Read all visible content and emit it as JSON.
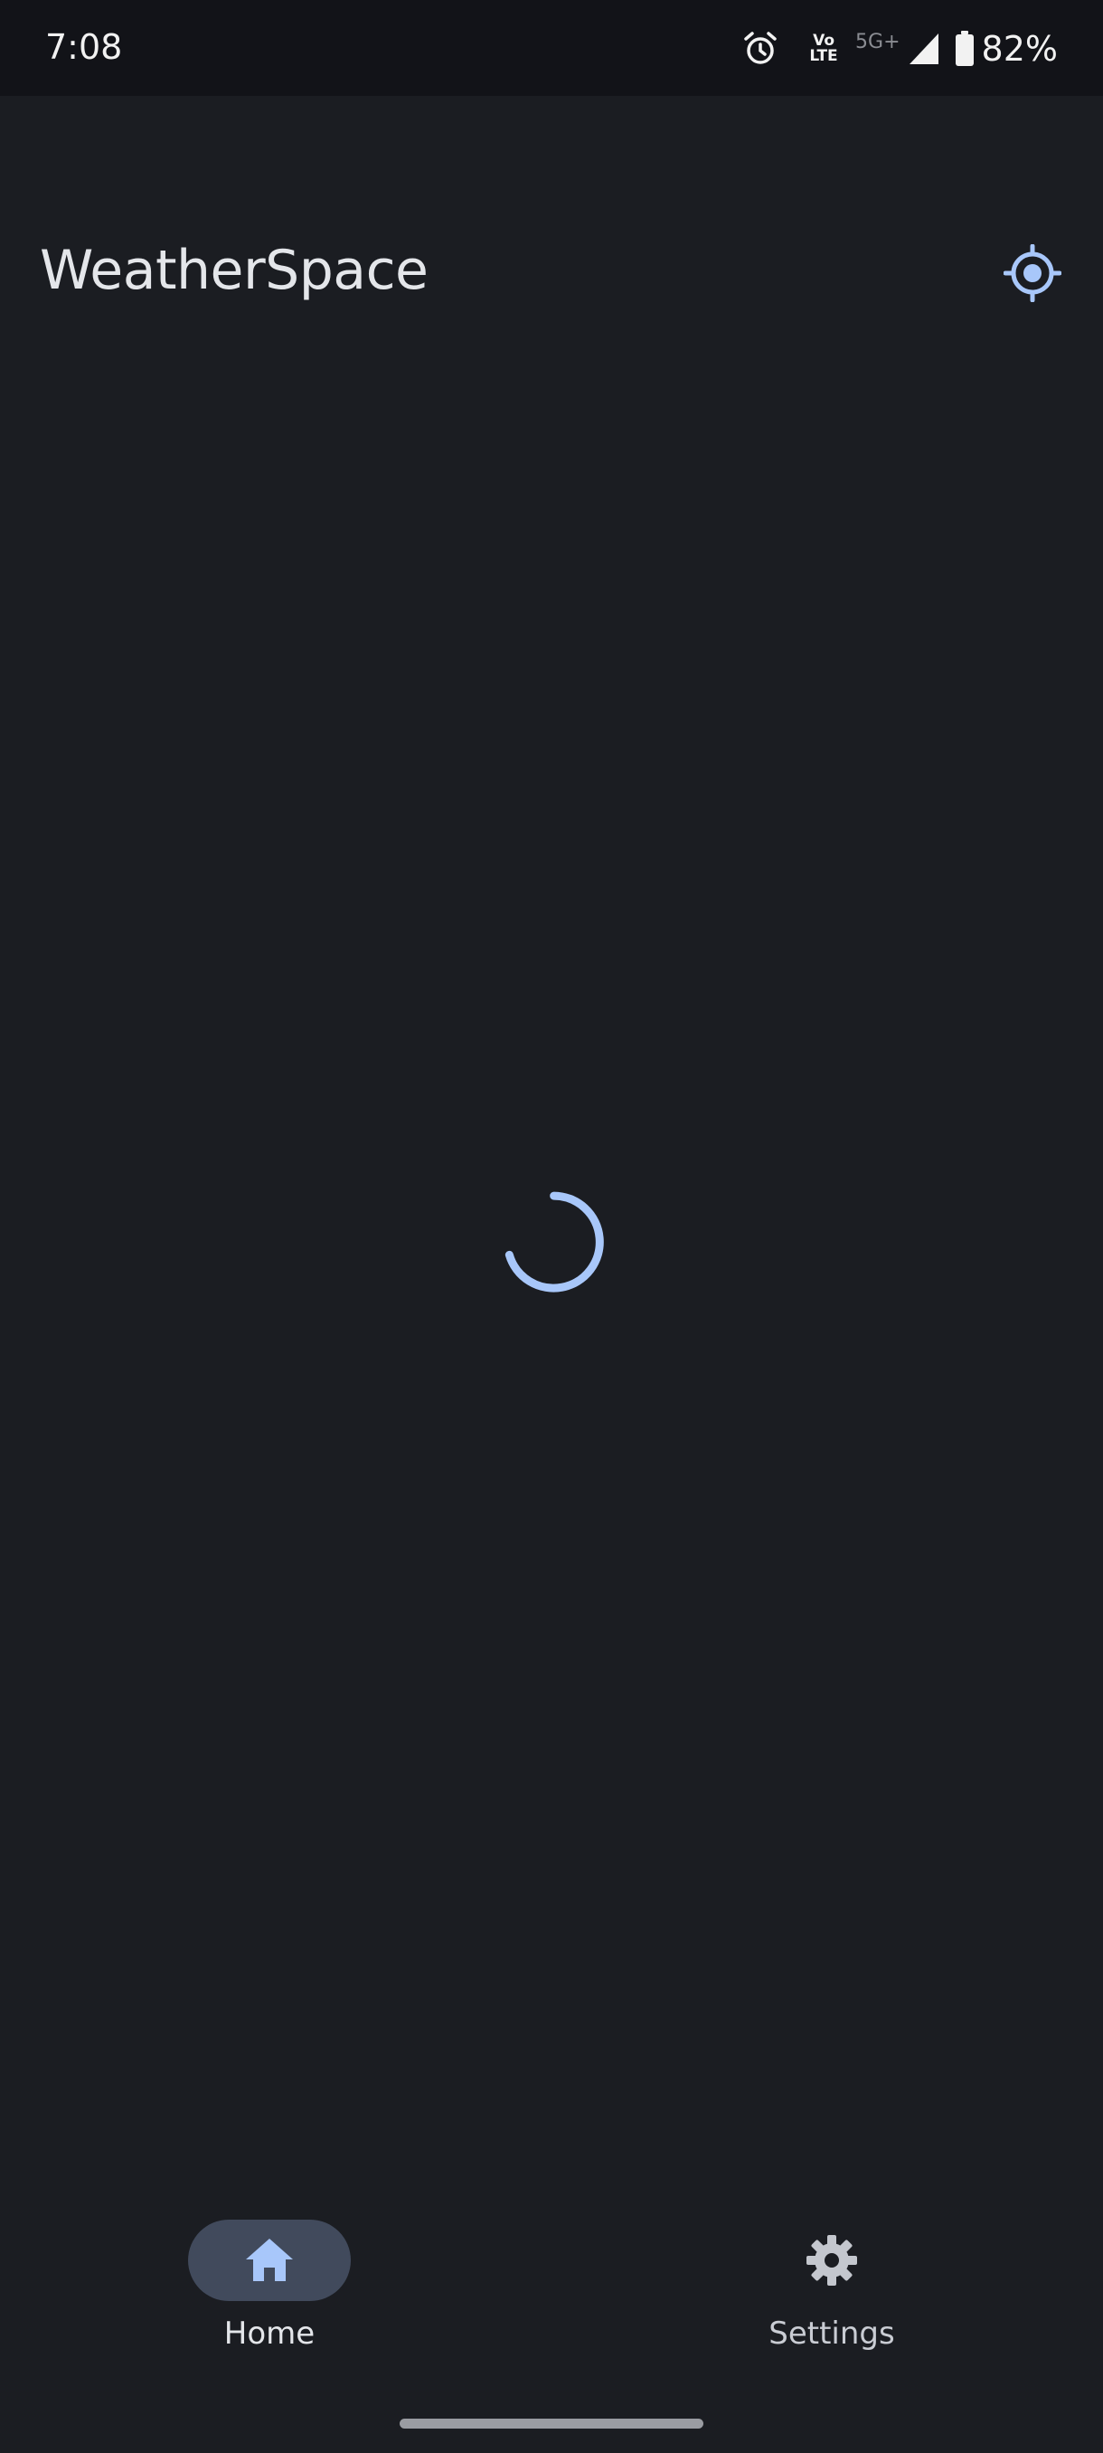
{
  "status_bar": {
    "time": "7:08",
    "volte_top": "Vo",
    "volte_bottom": "LTE",
    "network": "5G+",
    "battery": "82%",
    "icons": [
      "alarm-icon",
      "volte-icon",
      "signal-icon",
      "battery-icon"
    ]
  },
  "app_bar": {
    "title": "WeatherSpace",
    "action_icon": "my-location-icon"
  },
  "content": {
    "state": "loading",
    "spinner_icon": "progress-spinner"
  },
  "bottom_nav": {
    "items": [
      {
        "label": "Home",
        "icon": "home-icon",
        "selected": true
      },
      {
        "label": "Settings",
        "icon": "gear-icon",
        "selected": false
      }
    ]
  },
  "colors": {
    "background": "#1b1d22",
    "status_bar": "#121318",
    "accent": "#a8c7fa",
    "nav_indicator": "#414a5c",
    "text": "#e4e6ea"
  }
}
